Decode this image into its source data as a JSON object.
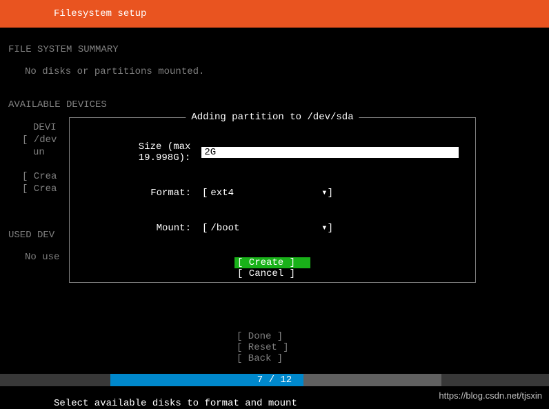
{
  "header": {
    "title": "Filesystem setup"
  },
  "summary": {
    "heading": "FILE SYSTEM SUMMARY",
    "text": "No disks or partitions mounted."
  },
  "available": {
    "heading": "AVAILABLE DEVICES",
    "lines": [
      "  DEVI",
      "[ /dev",
      "    un",
      "",
      "[ Crea",
      "[ Crea"
    ]
  },
  "used": {
    "heading": "USED DEV",
    "text": "No use"
  },
  "dialog": {
    "title": " Adding partition to /dev/sda ",
    "size_label": "Size (max 19.998G):",
    "size_value": "2G",
    "format_label": "Format:",
    "format_value": "ext4",
    "mount_label": "Mount:",
    "mount_value": "/boot",
    "create_button": "[ Create     ]",
    "cancel_button": "[ Cancel     ]",
    "arrow": "▾"
  },
  "bottom_buttons": {
    "done": "[ Done       ]",
    "reset": "[ Reset      ]",
    "back": "[ Back       ]"
  },
  "progress": {
    "text": "7 / 12"
  },
  "footer": {
    "text": "Select available disks to format and mount"
  },
  "watermark": "https://blog.csdn.net/tjsxin"
}
